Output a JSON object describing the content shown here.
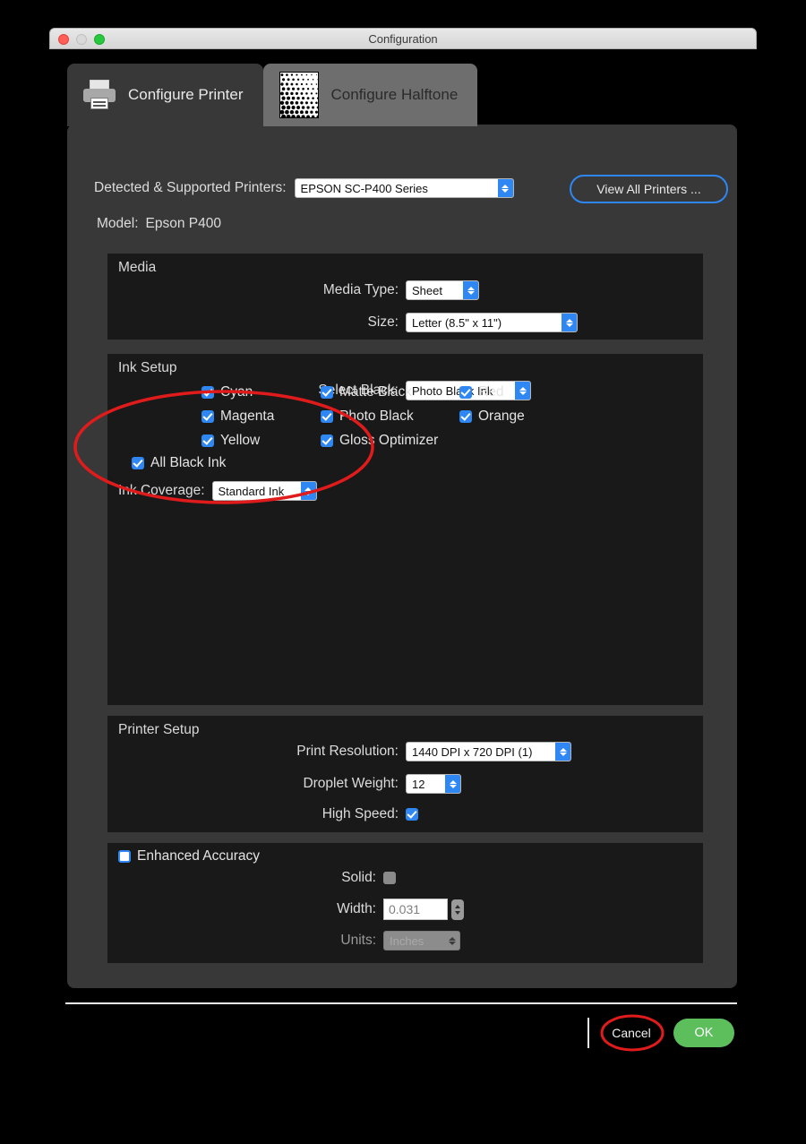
{
  "window": {
    "title": "Configuration",
    "traffic_lights": [
      "close-red",
      "minimize-gray",
      "maximize-green"
    ]
  },
  "tabs": [
    {
      "id": "configure-printer",
      "label": "Configure Printer",
      "icon": "printer-icon",
      "active": true
    },
    {
      "id": "configure-halftone",
      "label": "Configure Halftone",
      "icon": "halftone-pattern-icon",
      "active": false
    }
  ],
  "printer": {
    "detected_label": "Detected & Supported Printers:",
    "selected": "EPSON SC-P400 Series",
    "view_all_label": "View All Printers ...",
    "model_label": "Model:",
    "model_value": "Epson P400"
  },
  "media": {
    "title": "Media",
    "media_type_label": "Media Type:",
    "media_type_value": "Sheet",
    "size_label": "Size:",
    "size_value": "Letter (8.5\" x 11\")"
  },
  "ink_setup": {
    "title": "Ink Setup",
    "select_black_label": "Select Black:",
    "select_black_value": "Photo Black Ink",
    "all_black_ink_label": "All Black Ink",
    "all_black_ink_checked": true,
    "ink_coverage_label": "Ink Coverage:",
    "ink_coverage_value": "Standard Ink",
    "inks": [
      {
        "label": "Cyan",
        "checked": true
      },
      {
        "label": "Matte Black",
        "checked": true
      },
      {
        "label": "Red",
        "checked": true
      },
      {
        "label": "Magenta",
        "checked": true
      },
      {
        "label": "Photo Black",
        "checked": true
      },
      {
        "label": "Orange",
        "checked": true
      },
      {
        "label": "Yellow",
        "checked": true
      },
      {
        "label": "Gloss Optimizer",
        "checked": true
      },
      {
        "label": "",
        "checked": false
      }
    ]
  },
  "printer_setup": {
    "title": "Printer Setup",
    "print_resolution_label": "Print Resolution:",
    "print_resolution_value": "1440 DPI x 720 DPI (1)",
    "droplet_weight_label": "Droplet Weight:",
    "droplet_weight_value": "12",
    "high_speed_label": "High Speed:",
    "high_speed_checked": true
  },
  "enhanced_accuracy": {
    "title": "Enhanced Accuracy",
    "enabled": false,
    "solid_label": "Solid:",
    "solid_checked": false,
    "width_label": "Width:",
    "width_value": "0.031",
    "units_label": "Units:",
    "units_value": "Inches"
  },
  "footer": {
    "cancel_label": "Cancel",
    "ok_label": "OK"
  },
  "annotations": {
    "ellipse_ink_coverage": "red-ellipse-highlight",
    "ellipse_cancel": "red-ellipse-highlight",
    "color": "#e01b1b"
  }
}
